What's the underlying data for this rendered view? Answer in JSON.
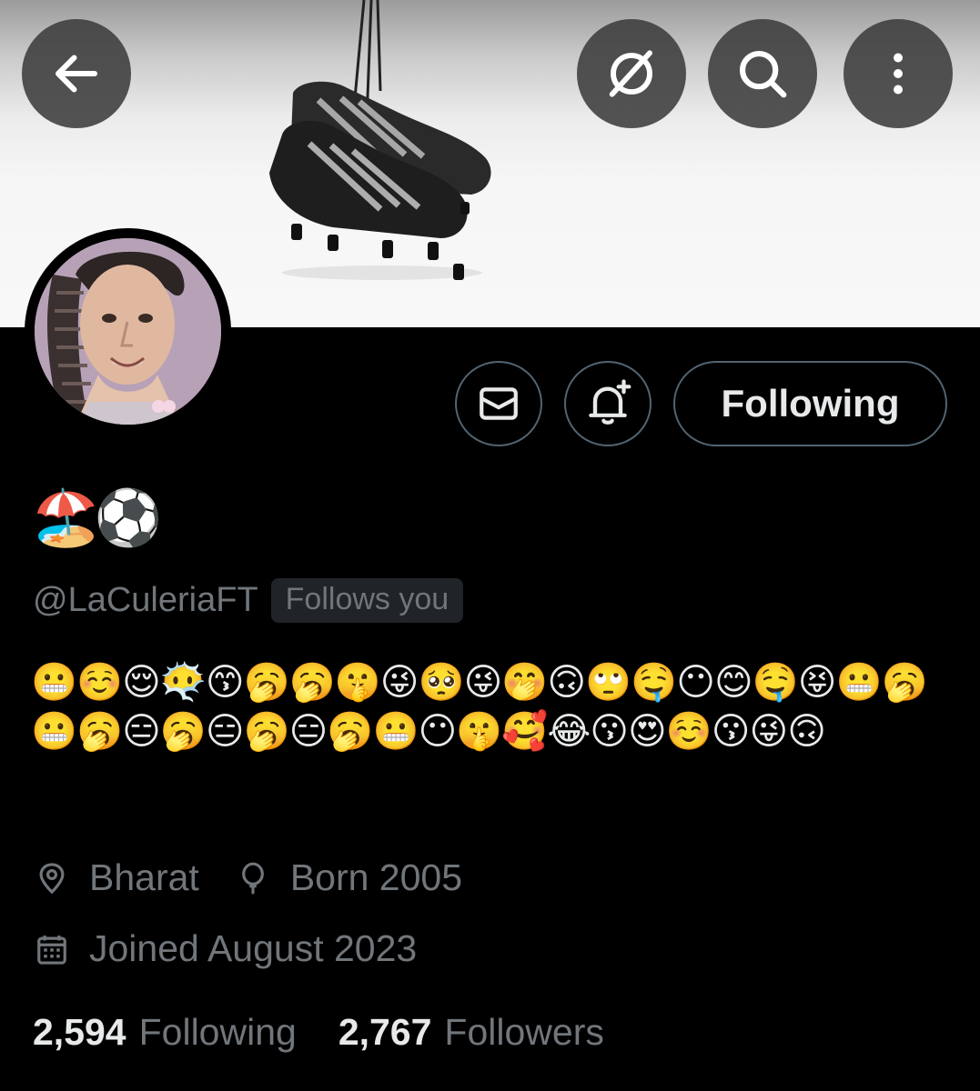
{
  "header": {
    "back_icon": "arrow-left-icon",
    "grok_icon": "grok-icon",
    "search_icon": "search-icon",
    "more_icon": "more-vertical-icon"
  },
  "profile": {
    "display_name": "🏖️⚽",
    "handle": "@LaCuleriaFT",
    "follows_you": "Follows you",
    "bio": "😬☺️😌😶‍🌫️😙🥱🥱🤫😜🥺😜🤭🙃🙄🤤😶😊🤤😝😬🥱😬🥱😑🥱😑🥱😑🥱😬😶🤫🥰😂😗😍☺️😗😜🙃",
    "location": "Bharat",
    "birth": "Born 2005",
    "joined": "Joined August 2023"
  },
  "actions": {
    "message_icon": "envelope-icon",
    "notify_icon": "bell-plus-icon",
    "follow_label": "Following"
  },
  "stats": {
    "following_count": "2,594",
    "following_label": "Following",
    "followers_count": "2,767",
    "followers_label": "Followers"
  },
  "colors": {
    "background": "#000000",
    "primary_text": "#e7e9ea",
    "secondary_text": "#71767b",
    "border": "#536471",
    "badge_bg": "#202327"
  }
}
